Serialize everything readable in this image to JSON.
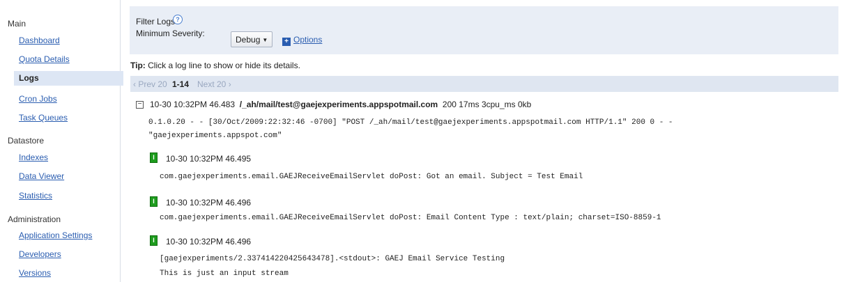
{
  "sidebar": {
    "sections": [
      {
        "title": "Main",
        "items": [
          {
            "label": "Dashboard",
            "active": false
          },
          {
            "label": "Quota Details",
            "active": false
          },
          {
            "label": "Logs",
            "active": true
          },
          {
            "label": "Cron Jobs",
            "active": false
          },
          {
            "label": "Task Queues",
            "active": false
          }
        ]
      },
      {
        "title": "Datastore",
        "items": [
          {
            "label": "Indexes",
            "active": false
          },
          {
            "label": "Data Viewer",
            "active": false
          },
          {
            "label": "Statistics",
            "active": false
          }
        ]
      },
      {
        "title": "Administration",
        "items": [
          {
            "label": "Application Settings",
            "active": false
          },
          {
            "label": "Developers",
            "active": false
          },
          {
            "label": "Versions",
            "active": false
          }
        ]
      }
    ]
  },
  "filter": {
    "title": "Filter Logs",
    "help_icon": "help-circle-icon",
    "severity_label": "Minimum Severity:",
    "severity_value": "Debug",
    "options_label": "Options"
  },
  "tip": {
    "prefix": "Tip:",
    "text": "Click a log line to show or hide its details."
  },
  "pager": {
    "prev": "‹ Prev 20",
    "range": "1-14",
    "next": "Next 20 ›"
  },
  "log": {
    "header": {
      "timestamp": "10-30 10:32PM 46.483",
      "path": "/_ah/mail/test@gaejexperiments.appspotmail.com",
      "stats": "200  17ms  3cpu_ms  0kb"
    },
    "request_line1": "0.1.0.20 - - [30/Oct/2009:22:32:46 -0700] \"POST /_ah/mail/test@gaejexperiments.appspotmail.com HTTP/1.1\" 200 0 - -",
    "request_line2": "\"gaejexperiments.appspot.com\"",
    "entries": [
      {
        "severity": "I",
        "timestamp": "10-30 10:32PM 46.495",
        "lines": [
          "com.gaejexperiments.email.GAEJReceiveEmailServlet doPost: Got an email. Subject = Test Email"
        ]
      },
      {
        "severity": "I",
        "timestamp": "10-30 10:32PM 46.496",
        "lines": [
          "com.gaejexperiments.email.GAEJReceiveEmailServlet doPost: Email Content Type : text/plain; charset=ISO-8859-1"
        ]
      },
      {
        "severity": "I",
        "timestamp": "10-30 10:32PM 46.496",
        "lines": [
          "[gaejexperiments/2.337414220425643478].<stdout>: GAEJ Email Service Testing",
          "This is just an input stream"
        ]
      }
    ]
  },
  "colors": {
    "link": "#2a5db0",
    "panel": "#e9eef6",
    "severity_info": "#1e9c1e"
  }
}
